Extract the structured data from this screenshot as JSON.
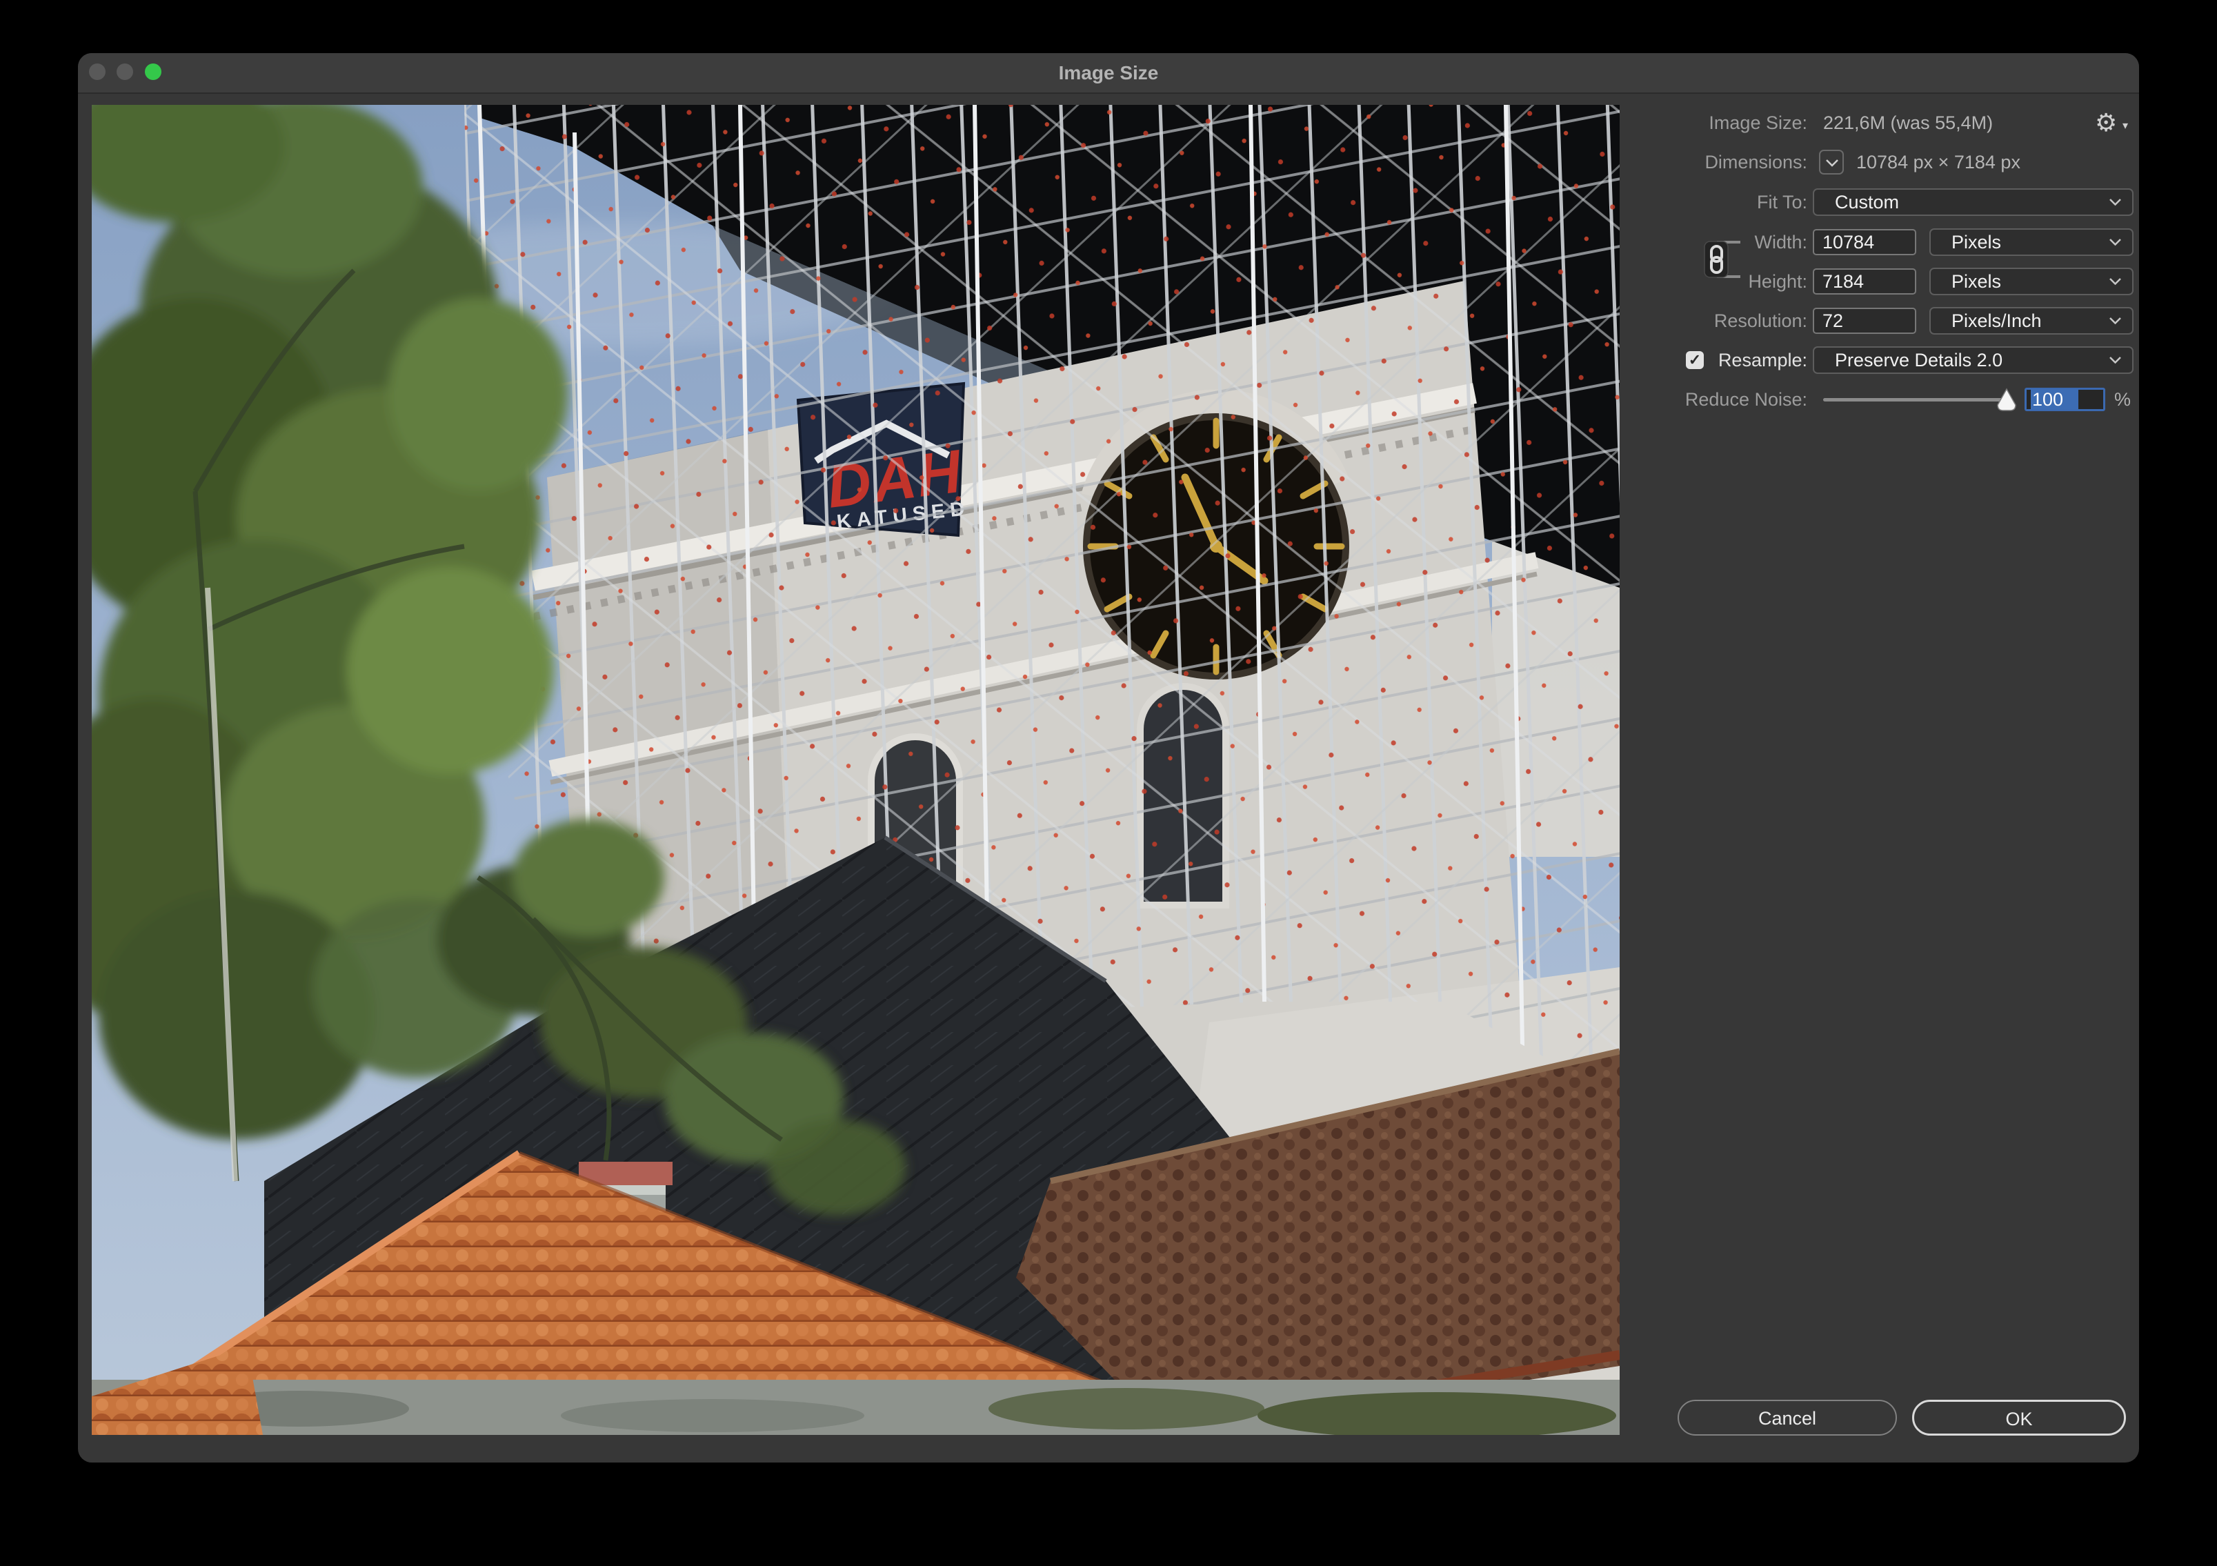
{
  "window": {
    "title": "Image Size"
  },
  "panel": {
    "image_size": {
      "label": "Image Size:",
      "value": "221,6M (was 55,4M)"
    },
    "dimensions": {
      "label": "Dimensions:",
      "value": "10784 px  ×  7184 px"
    },
    "fit_to": {
      "label": "Fit To:",
      "value": "Custom"
    },
    "width": {
      "label": "Width:",
      "value": "10784",
      "unit": "Pixels"
    },
    "height": {
      "label": "Height:",
      "value": "7184",
      "unit": "Pixels"
    },
    "resolution": {
      "label": "Resolution:",
      "value": "72",
      "unit": "Pixels/Inch"
    },
    "resample": {
      "label": "Resample:",
      "value": "Preserve Details 2.0",
      "checked": true
    },
    "reduce_noise": {
      "label": "Reduce Noise:",
      "value": "100",
      "suffix": "%"
    }
  },
  "buttons": {
    "cancel": "Cancel",
    "ok": "OK"
  },
  "icons": {
    "gear": "⚙",
    "gear_caret": "▾",
    "check": "✓"
  },
  "photo": {
    "banner_brand": "DAH",
    "banner_text": "KATUSED"
  },
  "colors": {
    "accent_blue": "#3b69b0",
    "selection_blue": "#3c6cb4",
    "traffic_green": "#34c84a",
    "titlebar": "#3d3d3d",
    "dialog_bg": "#373737"
  }
}
